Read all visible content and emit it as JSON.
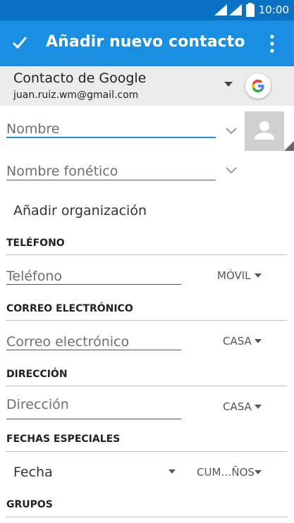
{
  "status_bar": {
    "time": "10:00"
  },
  "app_bar": {
    "title": "Añadir nuevo contacto"
  },
  "account": {
    "type": "Contacto de Google",
    "email": "juan.ruiz.wm@gmail.com"
  },
  "fields": {
    "name_placeholder": "Nombre",
    "phonetic_placeholder": "Nombre fonético",
    "add_organization": "Añadir organización"
  },
  "sections": {
    "phone": {
      "header": "TELÉFONO",
      "placeholder": "Teléfono",
      "type": "MÓVIL"
    },
    "email": {
      "header": "CORREO ELECTRÓNICO",
      "placeholder": "Correo electrónico",
      "type": "CASA"
    },
    "address": {
      "header": "DIRECCIÓN",
      "placeholder": "Dirección",
      "type": "CASA"
    },
    "dates": {
      "header": "FECHAS ESPECIALES",
      "date_placeholder": "Fecha",
      "type": "CUM…ÑOS"
    },
    "groups": {
      "header": "GRUPOS"
    }
  },
  "colors": {
    "status_bar": "#0a72c4",
    "app_bar": "#1a8ee1",
    "accent": "#1a8ee1",
    "account_bg": "#ececec"
  }
}
